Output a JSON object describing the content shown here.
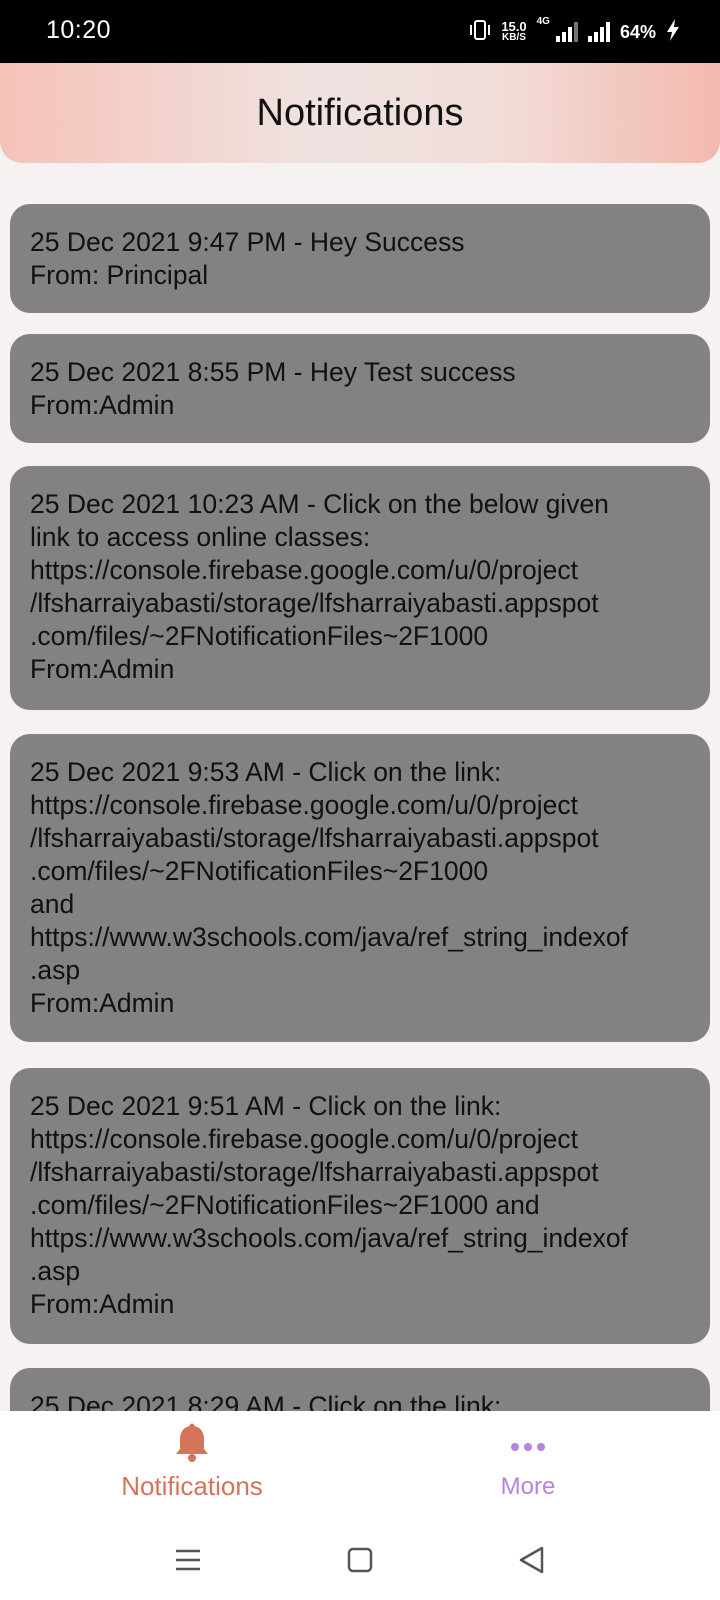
{
  "status_bar": {
    "time": "10:20",
    "net_speed_value": "15.0",
    "net_speed_unit": "KB/S",
    "network_type": "4G",
    "battery": "64%",
    "icons": [
      "vibrate-icon",
      "signal-icon",
      "signal-icon",
      "charging-icon"
    ]
  },
  "header": {
    "title": "Notifications"
  },
  "notifications": [
    {
      "lines": [
        "25 Dec 2021 9:47 PM - Hey Success",
        "From: Principal"
      ]
    },
    {
      "lines": [
        "25 Dec 2021 8:55 PM - Hey Test success",
        "From:Admin"
      ]
    },
    {
      "lines": [
        "25 Dec 2021 10:23 AM - Click on the below given",
        "link to access online classes:",
        "https://console.firebase.google.com/u/0/project",
        "/lfsharraiyabasti/storage/lfsharraiyabasti.appspot",
        ".com/files/~2FNotificationFiles~2F1000",
        "From:Admin"
      ]
    },
    {
      "lines": [
        "25 Dec 2021 9:53 AM - Click on the link:",
        "https://console.firebase.google.com/u/0/project",
        "/lfsharraiyabasti/storage/lfsharraiyabasti.appspot",
        ".com/files/~2FNotificationFiles~2F1000",
        "and",
        "https://www.w3schools.com/java/ref_string_indexof",
        ".asp",
        "From:Admin"
      ]
    },
    {
      "lines": [
        "25 Dec 2021 9:51 AM - Click on the link:",
        "https://console.firebase.google.com/u/0/project",
        "/lfsharraiyabasti/storage/lfsharraiyabasti.appspot",
        ".com/files/~2FNotificationFiles~2F1000 and",
        "https://www.w3schools.com/java/ref_string_indexof",
        ".asp",
        "From:Admin"
      ]
    },
    {
      "lines": [
        "25 Dec 2021 8:29 AM - Click on the link:"
      ]
    }
  ],
  "bottom_nav": {
    "items": [
      {
        "label": "Notifications",
        "icon": "bell-icon",
        "active": true,
        "color": "#d6735b"
      },
      {
        "label": "More",
        "icon": "more-dots-icon",
        "active": false,
        "color": "#b684e0"
      }
    ]
  },
  "system_nav": {
    "buttons": [
      "menu-icon",
      "home-icon",
      "back-icon"
    ]
  },
  "colors": {
    "card_bg": "#838181",
    "page_bg": "#f7f2f2",
    "header_gradient": [
      "#f6c2b8",
      "#efe3e1",
      "#f4b9ae"
    ]
  }
}
